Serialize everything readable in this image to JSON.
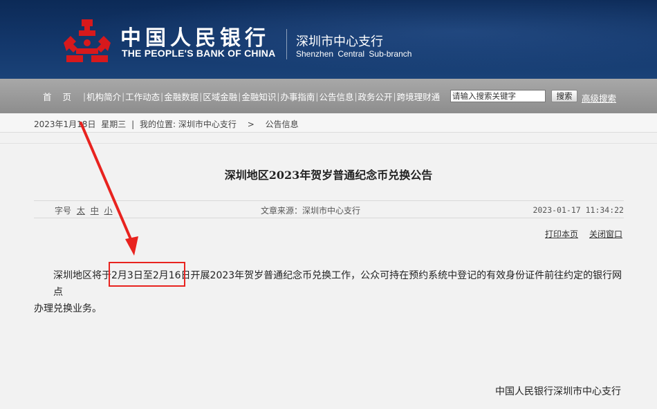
{
  "header": {
    "logo_cn": "中国人民银行",
    "logo_en": "THE PEOPLE'S BANK OF CHINA",
    "branch_cn": "深圳市中心支行",
    "branch_en": "Shenzhen Central Sub-branch",
    "logo_icon": "pboc-emblem-icon",
    "colors": {
      "banner": "#13376b",
      "emblem": "#d7191c"
    }
  },
  "nav": {
    "items": [
      {
        "label": "首页"
      },
      {
        "label": "机构简介"
      },
      {
        "label": "工作动态"
      },
      {
        "label": "金融数据"
      },
      {
        "label": "区域金融"
      },
      {
        "label": "金融知识"
      },
      {
        "label": "办事指南"
      },
      {
        "label": "公告信息"
      },
      {
        "label": "政务公开"
      },
      {
        "label": "跨境理财通"
      }
    ],
    "search_placeholder": "请输入搜索关键字",
    "search_button": "搜索",
    "advanced_search": "高级搜索"
  },
  "breadcrumb": {
    "date": "2023年1月18日",
    "weekday": "星期三",
    "separator": "|",
    "location_label": "我的位置:",
    "path": [
      "深圳市中心支行",
      "公告信息"
    ],
    "arrow": ">"
  },
  "article": {
    "title": "深圳地区2023年贺岁普通纪念币兑换公告",
    "font_size_label": "字号",
    "font_sizes": [
      "太",
      "中",
      "小"
    ],
    "source": "文章来源：深圳市中心支行",
    "datetime": "2023-01-17 11:34:22",
    "print_label": "打印本页",
    "close_label": "关闭窗口",
    "body_before": "深圳地区将于",
    "body_highlight": "2月3日至2月16日",
    "body_after": "开展2023年贺岁普通纪念币兑换工作，公众可持在预约系统中登记的有效身份证件前往约定的银行网点",
    "body_line2": "办理兑换业务。",
    "signature": "中国人民银行深圳市中心支行",
    "highlight_color": "#e8231f"
  }
}
